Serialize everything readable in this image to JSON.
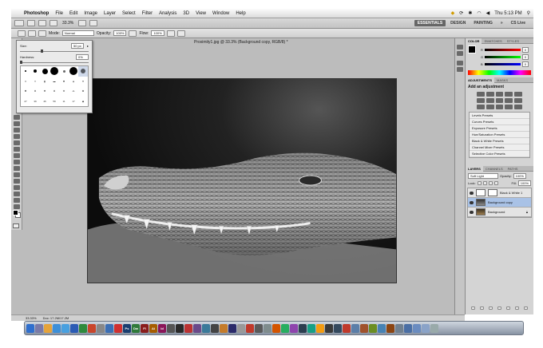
{
  "menubar": {
    "app": "Photoshop",
    "items": [
      "File",
      "Edit",
      "Image",
      "Layer",
      "Select",
      "Filter",
      "Analysis",
      "3D",
      "View",
      "Window",
      "Help"
    ],
    "clock": "Thu 5:13 PM"
  },
  "appbar": {
    "zoom": "33.3%",
    "workspaces": [
      "ESSENTIALS",
      "DESIGN",
      "PAINTING"
    ],
    "more": "»",
    "cs_live": "CS Live"
  },
  "options": {
    "mode_label": "Mode:",
    "mode_value": "Normal",
    "opacity_label": "Opacity:",
    "opacity_value": "100%",
    "flow_label": "Flow:",
    "flow_value": "100%"
  },
  "document": {
    "tab_title": "Proximity1.jpg @ 33.3% (Background copy, RGB/8) *"
  },
  "brush_popup": {
    "size_label": "Size:",
    "size_value": "50 px",
    "hardness_label": "Hardness:",
    "hardness_value": "0%",
    "presets": [
      "",
      "",
      "",
      "",
      "",
      "",
      "",
      "",
      "",
      "",
      "",
      "",
      "",
      "",
      "",
      "",
      "",
      "",
      "",
      "",
      "",
      "27",
      "39",
      "46",
      "59",
      "11",
      "17",
      ""
    ]
  },
  "panels": {
    "color_tabs": [
      "COLOR",
      "SWATCHES",
      "STYLES"
    ],
    "color_rows": [
      {
        "label": "R",
        "value": "0"
      },
      {
        "label": "G",
        "value": "0"
      },
      {
        "label": "B",
        "value": "0"
      }
    ],
    "adjust_tabs": [
      "ADJUSTMENTS",
      "MASKS"
    ],
    "adjust_title": "Add an adjustment",
    "presets": [
      "Levels Presets",
      "Curves Presets",
      "Exposure Presets",
      "Hue/Saturation Presets",
      "Black & White Presets",
      "Channel Mixer Presets",
      "Selective Color Presets"
    ],
    "layer_tabs": [
      "LAYERS",
      "CHANNELS",
      "PATHS"
    ],
    "blend_mode": "Soft Light",
    "opacity_label": "Opacity:",
    "opacity_value": "100%",
    "lock_label": "Lock:",
    "fill_label": "Fill:",
    "fill_value": "100%",
    "layers": [
      {
        "name": "Black & White 1"
      },
      {
        "name": "Background copy"
      },
      {
        "name": "Background"
      }
    ]
  },
  "status": {
    "zoom": "33.33%",
    "doc": "Doc: 17.2M/17.2M"
  },
  "dock": {
    "app_labels": [
      "Ps",
      "Dw",
      "Fl",
      "Ai",
      "Id"
    ]
  },
  "colors": {
    "selected_layer": "#a9c2e6",
    "essentials_active": "#666666",
    "cs_live": "#1a4f9e"
  }
}
